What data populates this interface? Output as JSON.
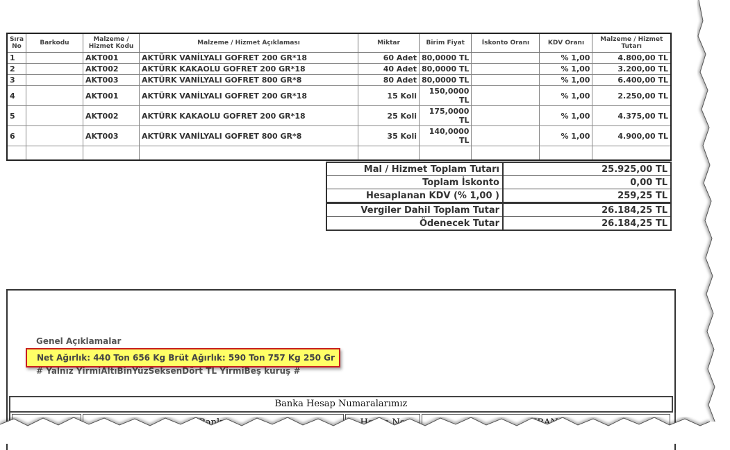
{
  "items_table": {
    "headers": [
      "Sıra No",
      "Barkodu",
      "Malzeme / Hizmet Kodu",
      "Malzeme / Hizmet Açıklaması",
      "Miktar",
      "Birim Fiyat",
      "İskonto Oranı",
      "KDV Oranı",
      "Malzeme / Hizmet Tutarı"
    ],
    "rows": [
      {
        "no": "1",
        "barcode": "",
        "code": "AKT001",
        "desc": "AKTÜRK VANİLYALI GOFRET 200 GR*18",
        "qty": "60 Adet",
        "price": "80,0000 TL",
        "discount": "",
        "vat": "% 1,00",
        "total": "4.800,00 TL"
      },
      {
        "no": "2",
        "barcode": "",
        "code": "AKT002",
        "desc": "AKTÜRK KAKAOLU GOFRET 200 GR*18",
        "qty": "40 Adet",
        "price": "80,0000 TL",
        "discount": "",
        "vat": "% 1,00",
        "total": "3.200,00 TL"
      },
      {
        "no": "3",
        "barcode": "",
        "code": "AKT003",
        "desc": "AKTÜRK VANİLYALI GOFRET 800 GR*8",
        "qty": "80 Adet",
        "price": "80,0000 TL",
        "discount": "",
        "vat": "% 1,00",
        "total": "6.400,00 TL"
      },
      {
        "no": "4",
        "barcode": "",
        "code": "AKT001",
        "desc": "AKTÜRK VANİLYALI GOFRET 200 GR*18",
        "qty": "15 Koli",
        "price": "150,0000 TL",
        "discount": "",
        "vat": "% 1,00",
        "total": "2.250,00 TL"
      },
      {
        "no": "5",
        "barcode": "",
        "code": "AKT002",
        "desc": "AKTÜRK KAKAOLU GOFRET 200 GR*18",
        "qty": "25 Koli",
        "price": "175,0000 TL",
        "discount": "",
        "vat": "% 1,00",
        "total": "4.375,00 TL"
      },
      {
        "no": "6",
        "barcode": "",
        "code": "AKT003",
        "desc": "AKTÜRK VANİLYALI GOFRET 800 GR*8",
        "qty": "35 Koli",
        "price": "140,0000 TL",
        "discount": "",
        "vat": "% 1,00",
        "total": "4.900,00 TL"
      }
    ]
  },
  "totals": [
    {
      "label": "Mal / Hizmet Toplam Tutarı",
      "value": "25.925,00 TL"
    },
    {
      "label": "Toplam İskonto",
      "value": "0,00 TL"
    },
    {
      "label": "Hesaplanan KDV (% 1,00 )",
      "value": "259,25 TL"
    },
    {
      "label": "Vergiler Dahil Toplam Tutar",
      "value": "26.184,25 TL"
    },
    {
      "label": "Ödenecek Tutar",
      "value": "26.184,25 TL"
    }
  ],
  "notes": {
    "title": "Genel Açıklamalar",
    "highlight": "Net Ağırlık: 440 Ton 656 Kg Brüt Ağırlık: 590 Ton 757 Kg 250 Gr",
    "amount_in_words": "# Yalnız YirmiAltıBinYüzSeksenDört TL YirmiBeş kuruş #"
  },
  "bank": {
    "title": "Banka Hesap Numaralarımız",
    "columns": [
      "Banka",
      "Hesap No",
      "IBAN"
    ]
  }
}
